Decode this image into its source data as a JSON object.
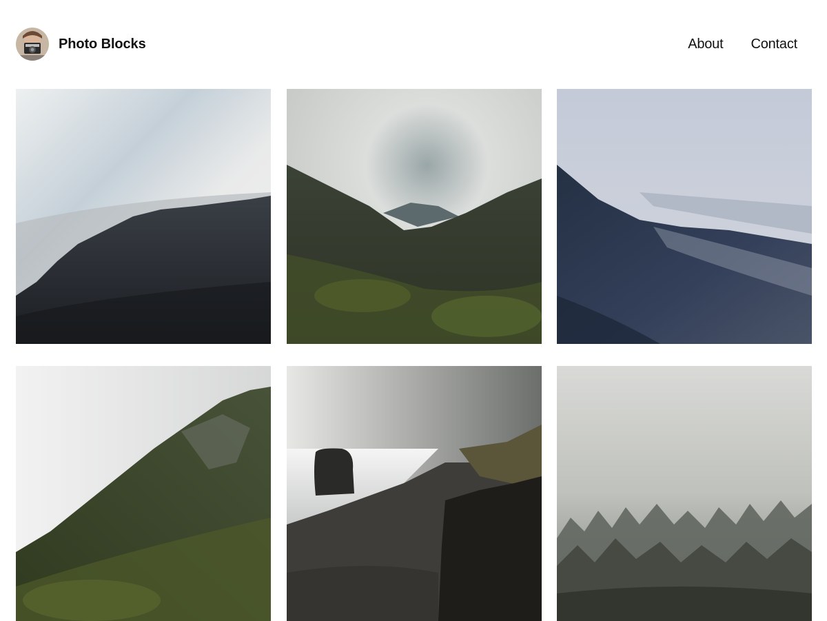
{
  "site": {
    "title": "Photo Blocks",
    "avatar_icon": "photographer-avatar"
  },
  "nav": {
    "items": [
      {
        "label": "About"
      },
      {
        "label": "Contact"
      }
    ]
  },
  "gallery": {
    "photos": [
      {
        "subject": "misty-forest-ridge",
        "tone": "#2a2f35"
      },
      {
        "subject": "cloudy-mountain-valley",
        "tone": "#3b4030"
      },
      {
        "subject": "snowy-forest-slope",
        "tone": "#2a3445"
      },
      {
        "subject": "green-cliff-in-fog",
        "tone": "#3f4a2a"
      },
      {
        "subject": "sea-stack-beach",
        "tone": "#3a3834"
      },
      {
        "subject": "foggy-pine-forest",
        "tone": "#5a5d58"
      }
    ]
  },
  "colors": {
    "background": "#ffffff",
    "text": "#111111"
  }
}
